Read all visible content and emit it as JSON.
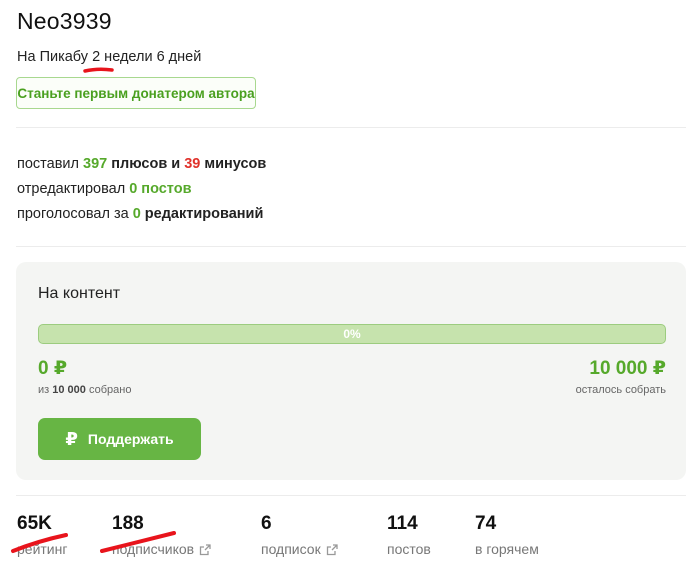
{
  "profile": {
    "username": "Neo3939",
    "since_prefix": "На Пикабу ",
    "since_number": "2",
    "since_suffix": " недели 6 дней",
    "donate_button": "Станьте первым донатером автора"
  },
  "activity": {
    "line1_prefix": "поставил ",
    "pluses": "397",
    "pluses_word": " плюсов и ",
    "minuses": "39",
    "minuses_word": " минусов",
    "line2_prefix": "отредактировал ",
    "edited_count": "0",
    "edited_word": " постов",
    "line3_prefix": "проголосовал за ",
    "voted_count": "0",
    "voted_word": " редактирований"
  },
  "fundraiser": {
    "title": "На контент",
    "progress_percent": 0,
    "progress_label": "0%",
    "collected": "0 ₽",
    "collected_caption_prefix": "из ",
    "goal_amount": "10 000",
    "collected_caption_suffix": " собрано",
    "remaining": "10 000 ₽",
    "remaining_caption": "осталось собрать",
    "support_button": "Поддержать",
    "support_icon": "ruble-icon"
  },
  "counters": [
    {
      "value": "65K",
      "label": "рейтинг"
    },
    {
      "value": "188",
      "label": "подписчиков",
      "icon": "external-link-icon"
    },
    {
      "value": "6",
      "label": "подписок",
      "icon": "external-link-icon"
    },
    {
      "value": "114",
      "label": "постов"
    },
    {
      "value": "74",
      "label": "в горячем"
    }
  ],
  "colors": {
    "accent_green": "#56a92b",
    "minus_red": "#e0322b",
    "annotation_red": "#e8141c",
    "button_green": "#67b544"
  }
}
